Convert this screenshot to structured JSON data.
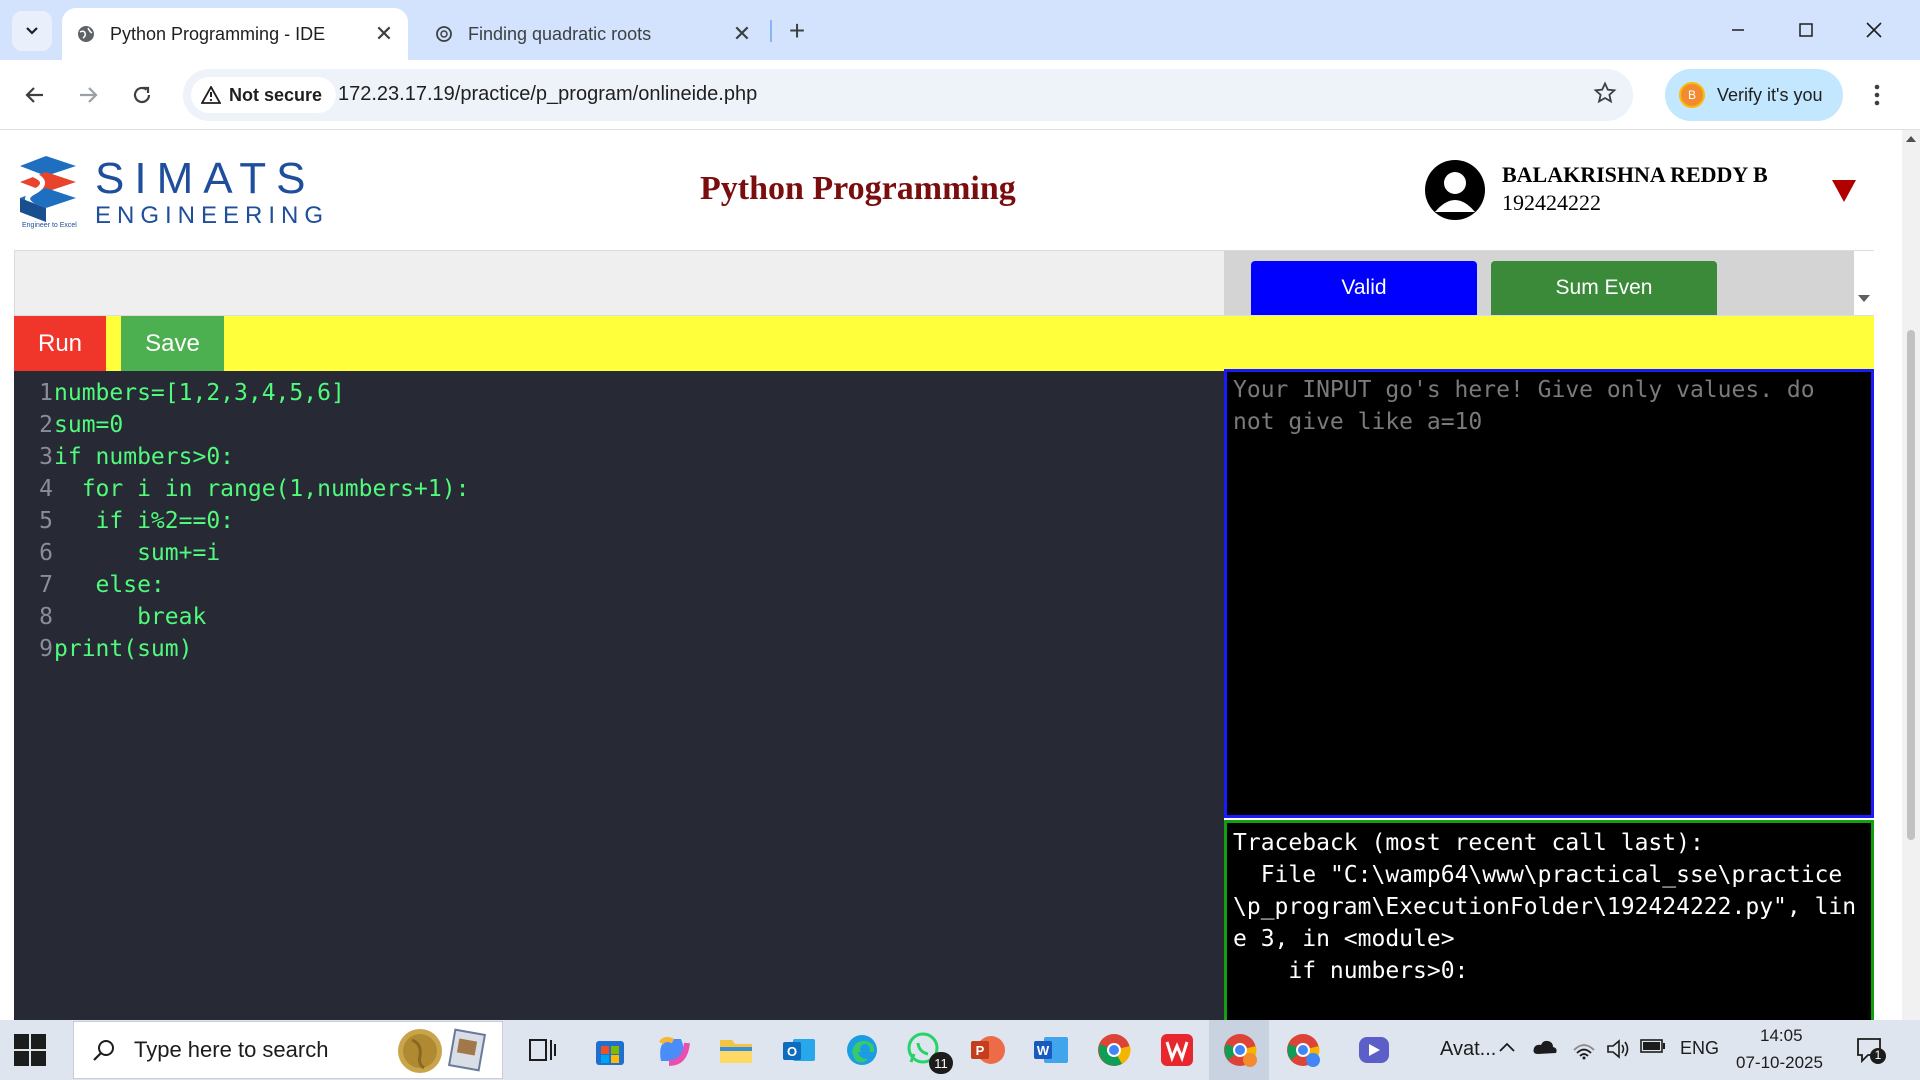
{
  "browser": {
    "tabs": [
      {
        "title": "Python Programming - IDE",
        "active": true
      },
      {
        "title": "Finding quadratic roots",
        "active": false
      }
    ],
    "security_label": "Not secure",
    "url": "172.23.17.19/practice/p_program/onlineide.php",
    "profile_label": "Verify it's you",
    "profile_initial": "B"
  },
  "header": {
    "logo_line1": "SIMATS",
    "logo_line2": "ENGINEERING",
    "logo_tagline": "Engineer to Excel",
    "title": "Python Programming",
    "user_name": "BALAKRISHNA REDDY B",
    "user_id": "192424222"
  },
  "questions": {
    "buttons": [
      {
        "label": "Valid",
        "color": "#0000ff"
      },
      {
        "label": "Sum Even",
        "color": "#3a8a3a"
      }
    ]
  },
  "actions": {
    "run_label": "Run",
    "save_label": "Save"
  },
  "editor": {
    "line_numbers": [
      "1",
      "2",
      "3",
      "4",
      "5",
      "6",
      "7",
      "8",
      "9"
    ],
    "lines": [
      "numbers=[1,2,3,4,5,6]",
      "sum=0",
      "if numbers>0:",
      "  for i in range(1,numbers+1):",
      "   if i%2==0:",
      "      sum+=i",
      "   else:",
      "      break",
      "print(sum)"
    ]
  },
  "input": {
    "placeholder": "Your INPUT go's here! Give only values. do not give like a=10"
  },
  "output": {
    "text": "Traceback (most recent call last):\n  File \"C:\\wamp64\\www\\practical_sse\\practice\\p_program\\ExecutionFolder\\192424222.py\", line 3, in <module>\n    if numbers>0:"
  },
  "taskbar": {
    "search_placeholder": "Type here to search",
    "whatsapp_badge": "11",
    "avatar_label": "Avat...",
    "language": "ENG",
    "time": "14:05",
    "date": "07-10-2025",
    "notification_count": "1"
  },
  "colors": {
    "accent_blue": "#0000ff",
    "accent_green": "#3a8a3a",
    "run_red": "#f0352b",
    "save_green": "#4caf50",
    "action_bar_yellow": "#ffff3b",
    "title_maroon": "#7a0d0d"
  }
}
